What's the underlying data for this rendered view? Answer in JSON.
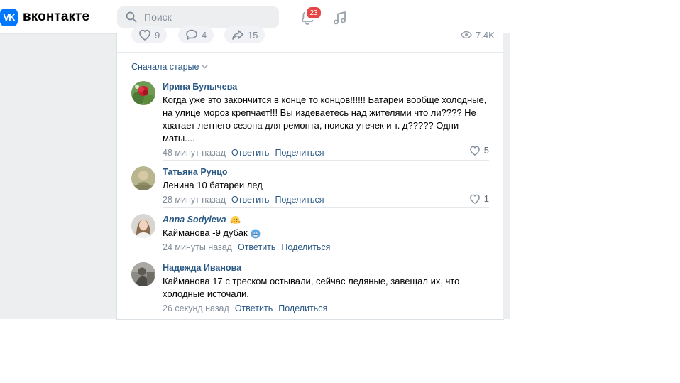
{
  "header": {
    "logo_text": "вконтакте",
    "logo_mark": "VK",
    "search_placeholder": "Поиск",
    "notifications_count": "23",
    "icons": [
      "search-icon",
      "bell-icon",
      "music-icon"
    ]
  },
  "post_actions": {
    "like_count": "9",
    "comment_count": "4",
    "share_count": "15",
    "views": "7.4K"
  },
  "comments_sort": {
    "label": "Сначала старые"
  },
  "comments": [
    {
      "author": "Ирина Булычева",
      "text": "Когда уже это закончится в конце то концов!!!!!! Батареи вообще холодные, на улице мороз крепчает!!! Вы издеваетесь над жителями что ли???? Не хватает летнего сезона для ремонта, поиска утечек и т. д????? Одни маты....",
      "time": "48 минут назад",
      "reply": "Ответить",
      "share": "Поделиться",
      "likes": "5"
    },
    {
      "author": "Татьяна Рунцо",
      "text": "Ленина 10 батареи лед",
      "time": "28 минут назад",
      "reply": "Ответить",
      "share": "Поделиться",
      "likes": "1"
    },
    {
      "author": "Anna Sodyleva",
      "text": "Кайманова -9 дубак",
      "time": "24 минуты назад",
      "reply": "Ответить",
      "share": "Поделиться"
    },
    {
      "author": "Надежда Иванова",
      "text": "Кайманова 17 с треском остывали, сейчас ледяные, завещал их, что холодные источали.",
      "time": "26 секунд назад",
      "reply": "Ответить",
      "share": "Поделиться"
    }
  ],
  "colors": {
    "accent": "#0077ff",
    "link": "#2a5885",
    "muted": "#818c99",
    "badge": "#e64646",
    "page_bg": "#edeef0"
  }
}
